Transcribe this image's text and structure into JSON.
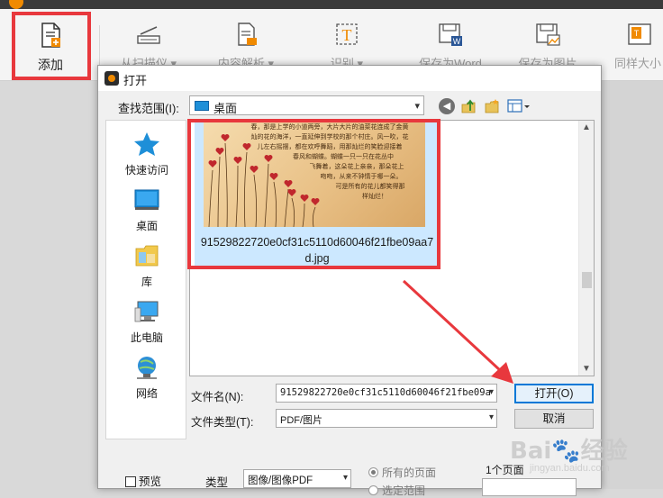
{
  "app": {
    "toolbar": [
      {
        "label": "添加",
        "icon": "add-file-icon"
      },
      {
        "label": "从扫描仪 ▾",
        "icon": "scanner-icon"
      },
      {
        "label": "内容解析 ▾",
        "icon": "content-parse-icon"
      },
      {
        "label": "识别 ▾",
        "icon": "text-recognize-icon"
      },
      {
        "label": "保存为Word",
        "icon": "save-word-icon"
      },
      {
        "label": "保存为图片",
        "icon": "save-image-icon"
      },
      {
        "label": "同样大小",
        "icon": "same-size-icon"
      }
    ]
  },
  "dialog": {
    "title": "打开",
    "lookin_label": "查找范围(I):",
    "lookin_value": "桌面",
    "places": [
      {
        "label": "快速访问",
        "icon": "quick-access-star-icon"
      },
      {
        "label": "桌面",
        "icon": "desktop-icon"
      },
      {
        "label": "库",
        "icon": "library-icon"
      },
      {
        "label": "此电脑",
        "icon": "this-pc-icon"
      },
      {
        "label": "网络",
        "icon": "network-icon"
      }
    ],
    "file": {
      "name_line1": "91529822720e0cf31c5110d60046f21fbe09aa7",
      "name_line2": "d.jpg",
      "thumb_text": [
        "春，那是上学的小道两旁，大片大片的油菜花连成了金黄",
        "灿的花的海洋，一直延伸到学校的那个村庄。风一吹，花",
        "儿左右摇摆，都在欢呼舞蹈，用那灿烂的笑脸迎接着",
        "春风和蝴蝶。蝴蝶一只一只在花丛中",
        "飞舞着，这朵花上亲亲，那朵花上",
        "吻吻，从来不钟情于哪一朵。",
        "可是所有的花儿都笑得那",
        "样灿烂！"
      ]
    },
    "filename_label": "文件名(N):",
    "filename_value": "91529822720e0cf31c5110d60046f21fbe09a",
    "filetype_label": "文件类型(T):",
    "filetype_value": "PDF/图片",
    "open_button": "打开(O)",
    "cancel_button": "取消",
    "preview_label": "预览",
    "type_label": "类型",
    "type_value": "图像/图像PDF",
    "radio_all_pages": "所有的页面",
    "radio_range": "选定范围",
    "page_count": "1个页面"
  },
  "watermark": {
    "text": "Bai🐾经验",
    "sub": "jingyan.baidu.com"
  },
  "colors": {
    "highlight_red": "#e8383d",
    "selection_blue": "#cce8ff",
    "accent_orange": "#f08a00"
  }
}
